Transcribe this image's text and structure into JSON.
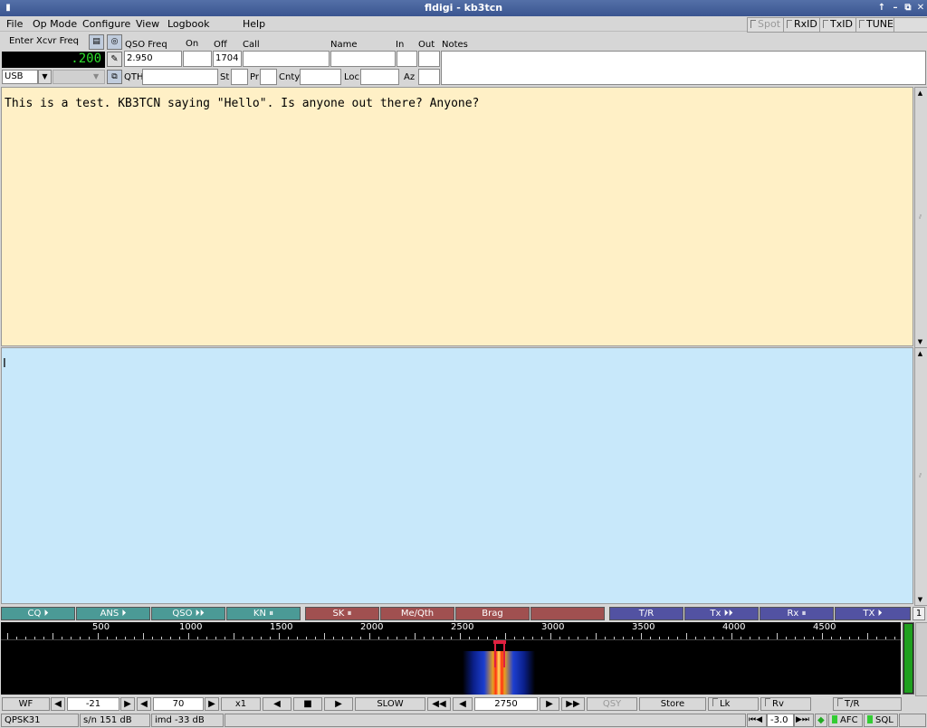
{
  "window": {
    "title": "fldigi - kb3tcn"
  },
  "menu": {
    "file": "File",
    "opmode": "Op Mode",
    "configure": "Configure",
    "view": "View",
    "logbook": "Logbook",
    "help": "Help"
  },
  "toggles": {
    "spot": "Spot",
    "rxid": "RxID",
    "txid": "TxID",
    "tune": "TUNE"
  },
  "rig": {
    "enter_freq": "Enter Xcvr Freq",
    "freq_display": ".200",
    "mode": "USB"
  },
  "log_labels": {
    "qso_freq": "QSO Freq",
    "on": "On",
    "off": "Off",
    "call": "Call",
    "name": "Name",
    "in": "In",
    "out": "Out",
    "notes": "Notes",
    "qth": "QTH",
    "st": "St",
    "pr": "Pr",
    "cnty": "Cnty",
    "loc": "Loc",
    "az": "Az"
  },
  "log_values": {
    "qso_freq": "2.950",
    "off": "1704"
  },
  "rx_text": "This is a test. KB3TCN saying \"Hello\". Is anyone out there? Anyone?",
  "macros": [
    "CQ ⏵",
    "ANS ⏵",
    "QSO ⏵⏵",
    "KN ⏸",
    "SK ⏸",
    "Me/Qth",
    "Brag",
    "",
    "T/R",
    "Tx ⏵⏵",
    "Rx ⏸",
    "TX ⏵"
  ],
  "macro_bank": "1",
  "scale_labels": [
    "500",
    "1000",
    "1500",
    "2000",
    "2500",
    "3000",
    "3500",
    "4000",
    "4500"
  ],
  "controls": {
    "wf": "WF",
    "reflevel": "-21",
    "range": "70",
    "zoom": "x1",
    "speed": "SLOW",
    "carrier": "2750",
    "qsy": "QSY",
    "store": "Store",
    "lk": "Lk",
    "rv": "Rv",
    "tr": "T/R"
  },
  "status": {
    "mode": "QPSK31",
    "sn": "s/n 151 dB",
    "imd": "imd -33 dB",
    "squelch": "-3.0",
    "afc": "AFC",
    "sql": "SQL"
  },
  "colors": {
    "rx_bg": "#fff0c6",
    "tx_bg": "#c8e8fa",
    "macro_teal": "#4b9a96",
    "macro_red": "#a05050",
    "macro_blue": "#5252a2"
  }
}
